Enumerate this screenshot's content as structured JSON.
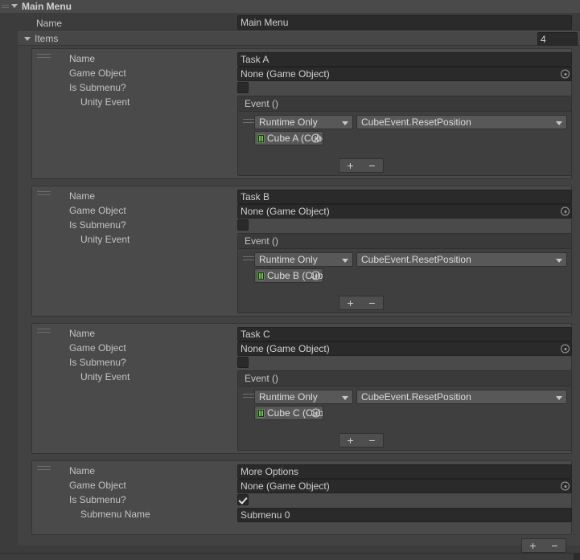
{
  "header": {
    "title": "Main Menu",
    "drag_icon": "drag-handle-icon",
    "foldout_icon": "foldout-arrow-down-icon"
  },
  "name_field": {
    "label": "Name",
    "value": "Main Menu"
  },
  "items_list": {
    "label": "Items",
    "size": "4",
    "foldout_icon": "foldout-arrow-down-icon",
    "add_label": "+",
    "remove_label": "−"
  },
  "labels": {
    "name": "Name",
    "game_object": "Game Object",
    "is_submenu": "Is Submenu?",
    "unity_event": "Unity Event",
    "submenu_name": "Submenu Name"
  },
  "event_panel": {
    "header": "Event ()",
    "callback_mode": "Runtime Only",
    "add_label": "+",
    "remove_label": "−"
  },
  "items": [
    {
      "name": "Task A",
      "game_object": "None (Game Object)",
      "is_submenu": false,
      "event": {
        "header": "Event ()",
        "mode": "Runtime Only",
        "function": "CubeEvent.ResetPosition",
        "target": "Cube A (Cube"
      }
    },
    {
      "name": "Task B",
      "game_object": "None (Game Object)",
      "is_submenu": false,
      "event": {
        "header": "Event ()",
        "mode": "Runtime Only",
        "function": "CubeEvent.ResetPosition",
        "target": "Cube B (Cube"
      }
    },
    {
      "name": "Task C",
      "game_object": "None (Game Object)",
      "is_submenu": false,
      "event": {
        "header": "Event ()",
        "mode": "Runtime Only",
        "function": "CubeEvent.ResetPosition",
        "target": "Cube C (Cube"
      }
    },
    {
      "name": "More Options",
      "game_object": "None (Game Object)",
      "is_submenu": true,
      "submenu_name": "Submenu 0"
    }
  ],
  "colors": {
    "window_bg": "#3c3c3c",
    "header_bg": "#4a4a4a",
    "card_bg": "#4a4a4a",
    "list_bg": "#424242",
    "field_bg": "#2a2a2a",
    "popup_bg": "#585858",
    "text": "#c4c4c4",
    "prefab_icon_green": "#6cc24a"
  }
}
